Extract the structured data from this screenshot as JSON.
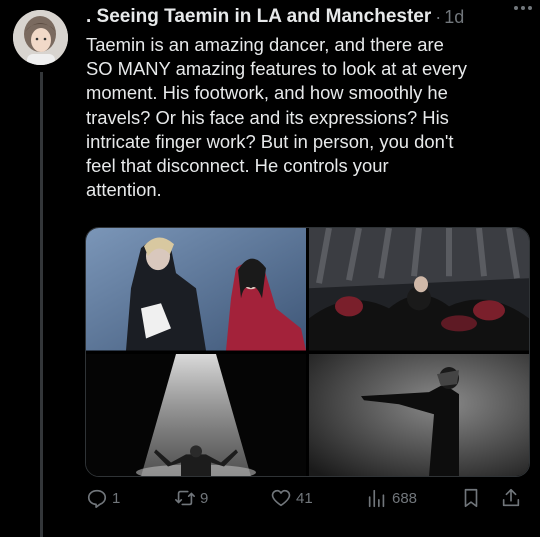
{
  "tweet": {
    "author": ". Seeing Taemin in LA and Manchester",
    "separator": "·",
    "time": "1d",
    "text_lines": [
      "Taemin is an amazing dancer, and there are",
      "SO MANY amazing features to look at at every",
      "moment. His footwork, and how smoothly he",
      "travels? Or his face and its expressions? His",
      "intricate finger work? But in person, you don't",
      "feel that disconnect. He controls your",
      "attention."
    ]
  },
  "actions": {
    "replies": "1",
    "reposts": "9",
    "likes": "41",
    "views": "688"
  },
  "icons": {
    "reply": "reply-icon",
    "repost": "repost-icon",
    "like": "heart-icon",
    "views": "views-icon",
    "bookmark": "bookmark-icon",
    "share": "share-icon",
    "more": "more-icon"
  },
  "colors": {
    "background": "#000000",
    "text": "#e7e9ea",
    "muted": "#71767b"
  }
}
